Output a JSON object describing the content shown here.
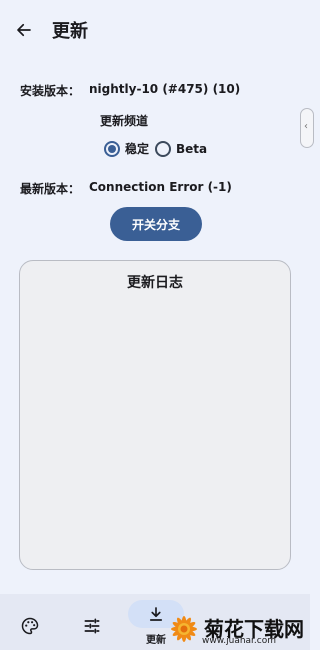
{
  "header": {
    "title": "更新",
    "back_icon": "arrow-left-icon"
  },
  "info": {
    "installed_label": "安装版本：",
    "installed_value": "nightly-10 (#475) (10)",
    "latest_label": "最新版本：",
    "latest_value": "Connection Error (-1)"
  },
  "channel": {
    "title": "更新频道",
    "options": [
      {
        "label": "稳定",
        "selected": true
      },
      {
        "label": "Beta",
        "selected": false
      }
    ]
  },
  "switch_button": {
    "label": "开关分支"
  },
  "changelog": {
    "title": "更新日志"
  },
  "bottom_nav": {
    "items": [
      {
        "icon": "palette-icon",
        "label": ""
      },
      {
        "icon": "sliders-icon",
        "label": ""
      },
      {
        "icon": "download-icon",
        "label": "更新",
        "active": true
      }
    ]
  },
  "watermark": {
    "text": "菊花下载网",
    "url": "www.juahar.com"
  },
  "colors": {
    "accent": "#3a5f95",
    "background": "#eef2fb",
    "nav_background": "#e4e8f3",
    "active_pill": "#d3e0f7"
  }
}
